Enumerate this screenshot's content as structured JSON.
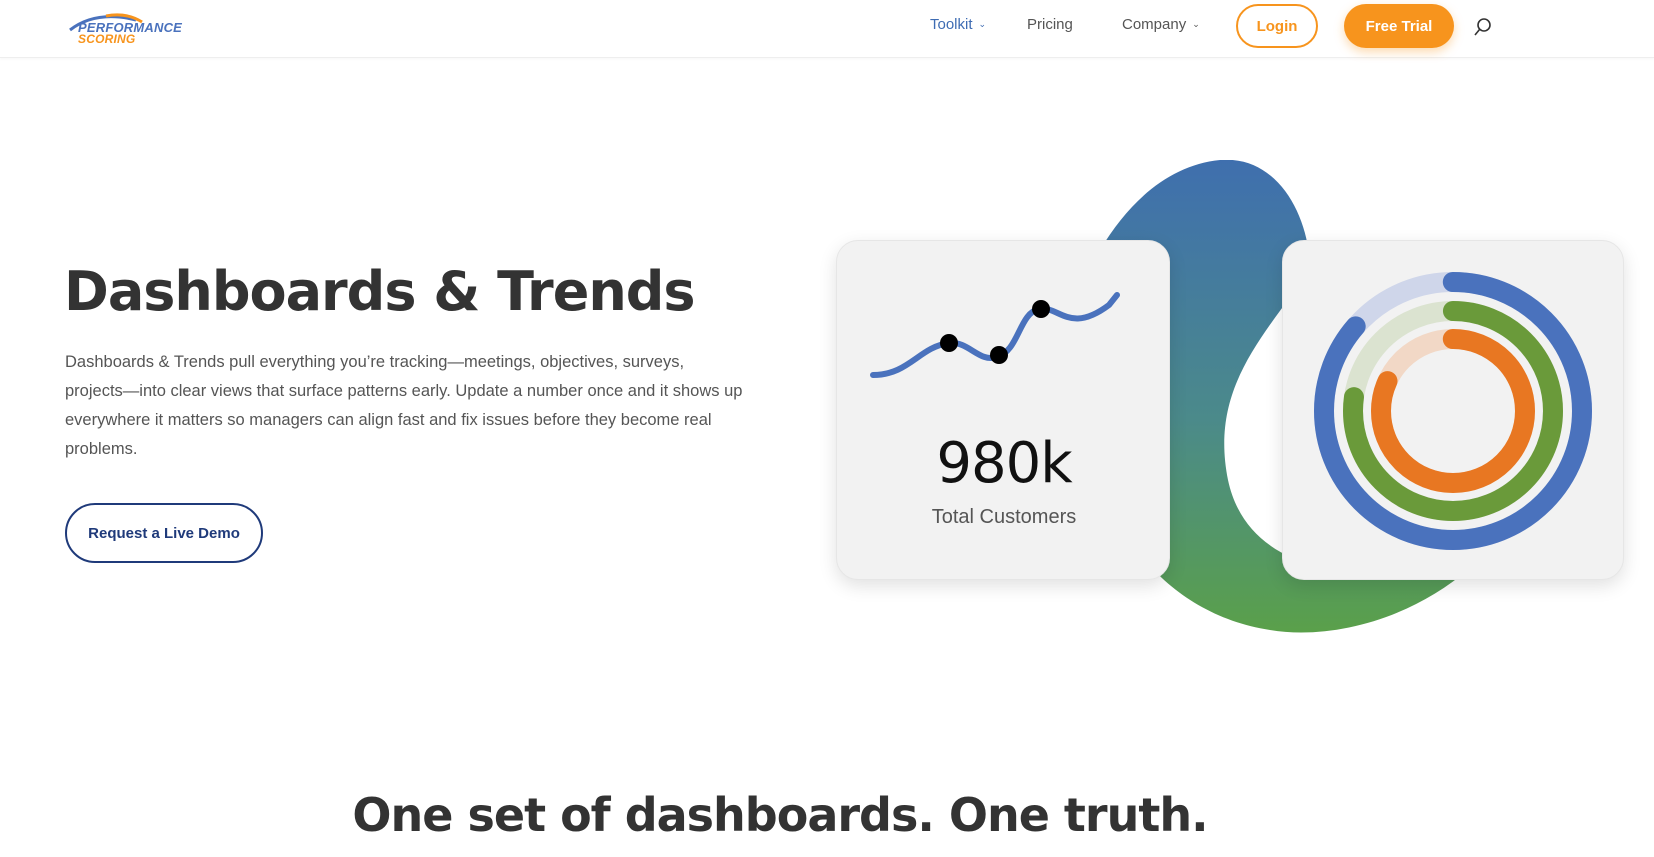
{
  "header": {
    "logo": {
      "line1": "PERFORMANCE",
      "line2": "SCORING"
    },
    "nav": [
      {
        "label": "Toolkit",
        "active": true,
        "dropdown": true
      },
      {
        "label": "Pricing",
        "active": false,
        "dropdown": false
      },
      {
        "label": "Company",
        "active": false,
        "dropdown": true
      }
    ],
    "login_label": "Login",
    "trial_label": "Free Trial",
    "search_icon": "search-icon"
  },
  "hero": {
    "title": "Dashboards & Trends",
    "description": "Dashboards & Trends pull everything you’re tracking—meetings, objectives, surveys, projects—into clear views that surface patterns early. Update a number once and it shows up everywhere it matters so managers can align fast and fix issues before they become real problems.",
    "cta_label": "Request a Live Demo"
  },
  "cards": {
    "metric_value": "980k",
    "metric_label": "Total Customers"
  },
  "section": {
    "title": "One set of dashboards. One truth."
  },
  "colors": {
    "brand_blue": "#4a72bd",
    "brand_orange": "#f7941d",
    "ring_blue": "#4a72bd",
    "ring_green": "#6a9a3a",
    "ring_orange": "#e87722",
    "demo_navy": "#1f3a7a"
  }
}
